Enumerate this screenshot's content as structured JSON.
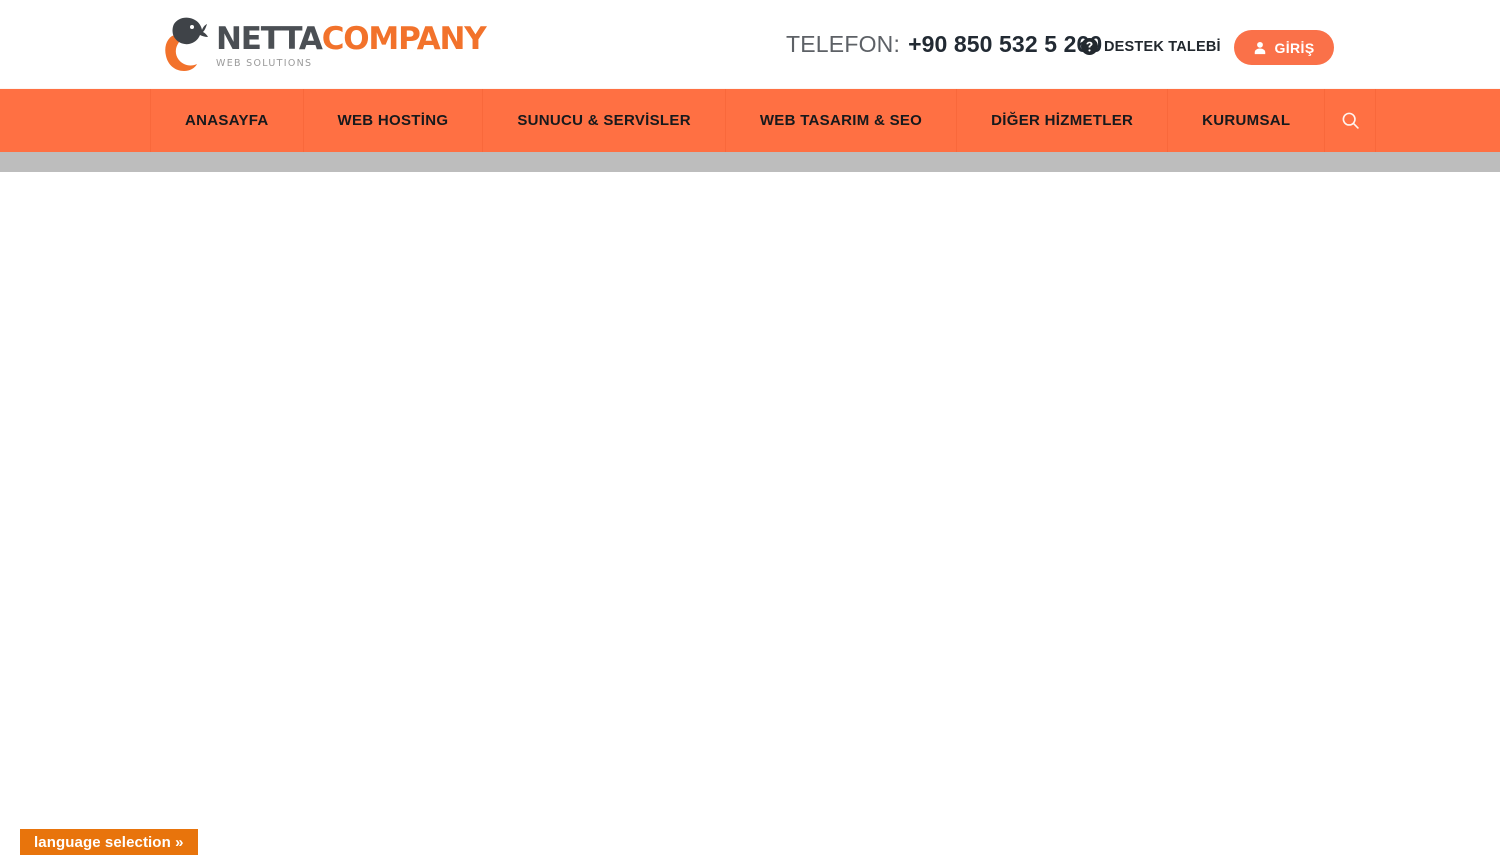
{
  "header": {
    "logo": {
      "mark_icon": "netta-bird-logo-icon",
      "name_primary": "NETTA",
      "name_secondary": "COMPANY",
      "tagline": "WEB SOLUTIONS",
      "color_primary": "#4b4f54",
      "color_secondary": "#f2722b"
    },
    "phone": {
      "label": "TELEFON:",
      "number": "+90 850 532 5 260"
    },
    "support": {
      "icon": "question-mark-circle-icon",
      "label": "DESTEK TALEBİ"
    },
    "login": {
      "icon": "user-person-icon",
      "label": "GİRİŞ",
      "color": "#fa7149"
    }
  },
  "nav": {
    "background_color": "#ff7043",
    "divider_color": "#f9683b",
    "text_color": "#17191c",
    "items": [
      {
        "label": "ANASAYFA"
      },
      {
        "label": "WEB HOSTİNG"
      },
      {
        "label": "SUNUCU & SERVİSLER"
      },
      {
        "label": "WEB TASARIM & SEO"
      },
      {
        "label": "DİĞER HİZMETLER"
      },
      {
        "label": "KURUMSAL"
      }
    ],
    "search": {
      "icon": "search-magnifier-icon"
    }
  },
  "strip": {
    "color": "#bdbdbd"
  },
  "content": {
    "background_color": "#ffffff"
  },
  "language_selector": {
    "label": "language selection »",
    "color": "#e8740c"
  }
}
